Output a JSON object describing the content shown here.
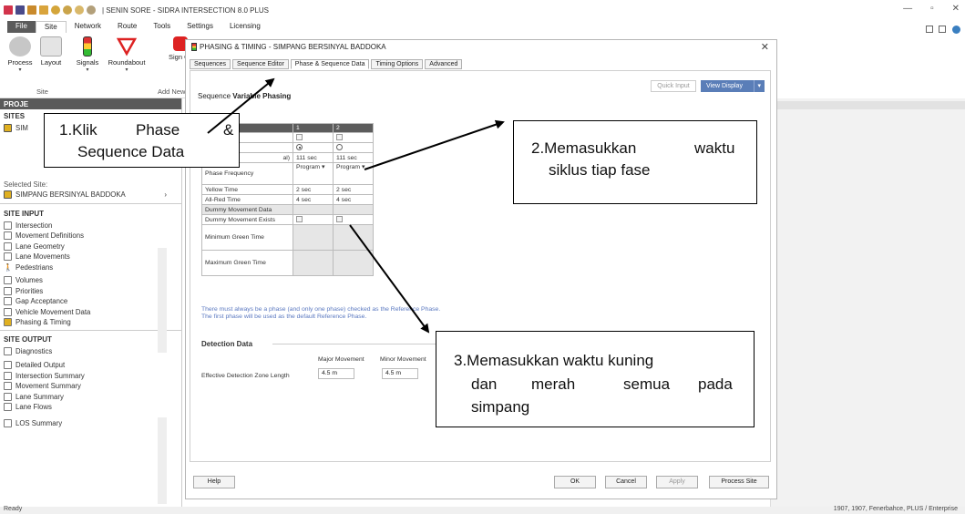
{
  "window": {
    "title": "| SENIN SORE - SIDRA INTERSECTION 8.0 PLUS",
    "minimize": "—",
    "restore": "▫",
    "close": "✕"
  },
  "menu": [
    "File",
    "Site",
    "Network",
    "Route",
    "Tools",
    "Settings",
    "Licensing"
  ],
  "ribbon": {
    "buttons": [
      "Process",
      "Layout",
      "Signals",
      "Roundabout",
      "Sign Control"
    ],
    "groups": [
      "Site",
      "Add New"
    ]
  },
  "left_panel": {
    "project_label": "PROJE",
    "sites_label": "SITES",
    "site_short": "SIM",
    "selected_site_label": "Selected Site:",
    "selected_site": "SIMPANG BERSINYAL BADDOKA",
    "site_input_label": "SITE INPUT",
    "site_input_items": [
      "Intersection",
      "Movement Definitions",
      "Lane Geometry",
      "Lane Movements",
      "Pedestrians",
      "Volumes",
      "Priorities",
      "Gap Acceptance",
      "Vehicle Movement Data",
      "Phasing & Timing"
    ],
    "site_output_label": "SITE OUTPUT",
    "site_output_items": [
      "Diagnostics",
      "Detailed Output",
      "Intersection Summary",
      "Movement Summary",
      "Lane Summary",
      "Lane Flows",
      "LOS Summary"
    ]
  },
  "status_bar": {
    "left": "Ready",
    "right": "1907, 1907, Fenerbahce, PLUS / Enterprise"
  },
  "dialog": {
    "title": "PHASING & TIMING - SIMPANG BERSINYAL BADDOKA",
    "close": "✕",
    "tabs": [
      "Sequences",
      "Sequence Editor",
      "Phase & Sequence Data",
      "Timing Options",
      "Advanced"
    ],
    "active_tab": "Phase & Sequence Data",
    "sequence_prefix": "Sequence",
    "sequence_name": "Variable Phasing",
    "quick_input": "Quick Input",
    "view_display": "View Display",
    "table": {
      "col1": "1",
      "col2": "2",
      "row_green_label": "al)",
      "green_1": "111 sec",
      "green_2": "111 sec",
      "phase_frequency_label": "Phase Frequency",
      "freq_1": "Program",
      "freq_2": "Program",
      "yellow_label": "Yellow Time",
      "yellow_1": "2 sec",
      "yellow_2": "2 sec",
      "allred_label": "All-Red Time",
      "allred_1": "4 sec",
      "allred_2": "4 sec",
      "dummy_header": "Dummy Movement Data",
      "dummy_exists": "Dummy Movement Exists",
      "min_green": "Minimum Green Time",
      "max_green": "Maximum Green Time"
    },
    "note_line1": "There must always be a phase (and only one phase) checked as the Reference Phase.",
    "note_line2": "The first phase will be used as the default Reference Phase.",
    "detection_title": "Detection Data",
    "major_movement": "Major Movement",
    "minor_movement": "Minor Movement",
    "detection_label": "Effective Detection Zone Length",
    "major_value": "4.5 m",
    "minor_value": "4.5 m",
    "buttons": {
      "help": "Help",
      "ok": "OK",
      "cancel": "Cancel",
      "apply": "Apply",
      "process_site": "Process Site"
    }
  },
  "callouts": {
    "c1_line1_a": "1.Klik",
    "c1_line1_b": "Phase",
    "c1_line1_c": "&",
    "c1_line2": "Sequence Data",
    "c2_line1_a": "2.Memasukkan",
    "c2_line1_b": "waktu",
    "c2_line2": "siklus tiap fase",
    "c3_line1": "3.Memasukkan waktu kuning",
    "c3_line2_a": "dan",
    "c3_line2_b": "merah",
    "c3_line2_c": "semua",
    "c3_line2_d": "pada",
    "c3_line3": "simpang"
  },
  "colors": {
    "view_display": "#5a7eb8",
    "note_text": "#5a78c0",
    "table_header": "#5c5c5c",
    "file_menu": "#5b5b5b"
  }
}
